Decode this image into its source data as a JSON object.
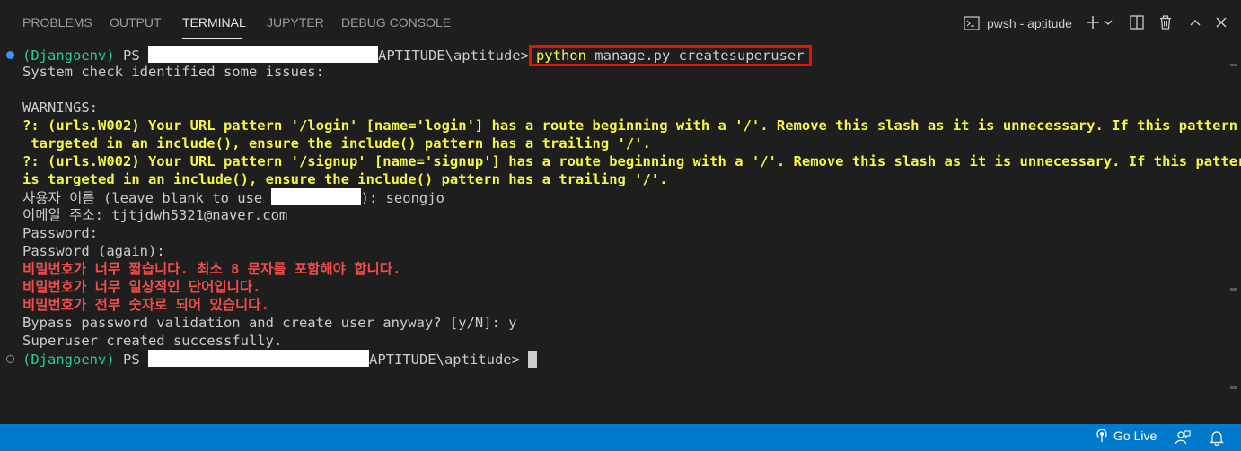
{
  "panel": {
    "tabs": [
      "PROBLEMS",
      "OUTPUT",
      "TERMINAL",
      "JUPYTER",
      "DEBUG CONSOLE"
    ],
    "active_tab": "TERMINAL",
    "terminal_name": "pwsh - aptitude"
  },
  "terminal": {
    "prompt_env": "(Djangoenv)",
    "prompt_ps": " PS ",
    "prompt_path_tail": "APTITUDE\\aptitude>",
    "command_python": "python",
    "command_rest": " manage.py createsuperuser",
    "line_check": "System check identified some issues:",
    "line_warnings": "WARNINGS:",
    "warn1_a": "?: (urls.W002) Your URL pattern '/login' [name='login'] has a route beginning with a '/'. Remove this slash as it is unnecessary. If this pattern is",
    "warn1_b": " targeted in an include(), ensure the include() pattern has a trailing '/'.",
    "warn2_a": "?: (urls.W002) Your URL pattern '/signup' [name='signup'] has a route beginning with a '/'. Remove this slash as it is unnecessary. If this pattern",
    "warn2_b": "is targeted in an include(), ensure the include() pattern has a trailing '/'.",
    "username_prompt": "사용자 이름 (leave blank to use ",
    "username_value": "): seongjo",
    "email_line": "이메일 주소: tjtjdwh5321@naver.com",
    "password1": "Password:",
    "password2": "Password (again):",
    "err1": "비밀번호가 너무 짧습니다. 최소 8 문자를 포함해야 합니다.",
    "err2": "비밀번호가 너무 일상적인 단어입니다.",
    "err3": "비밀번호가 전부 숫자로 되어 있습니다.",
    "bypass": "Bypass password validation and create user anyway? [y/N]: y",
    "success": "Superuser created successfully."
  },
  "statusbar": {
    "golive": "Go Live",
    "color": "#007acc"
  },
  "icons": [
    "terminal-icon",
    "plus-icon",
    "chevron-down-icon",
    "split-icon",
    "trash-icon",
    "chevron-up-icon",
    "close-icon",
    "broadcast-icon",
    "feedback-icon",
    "bell-icon"
  ]
}
